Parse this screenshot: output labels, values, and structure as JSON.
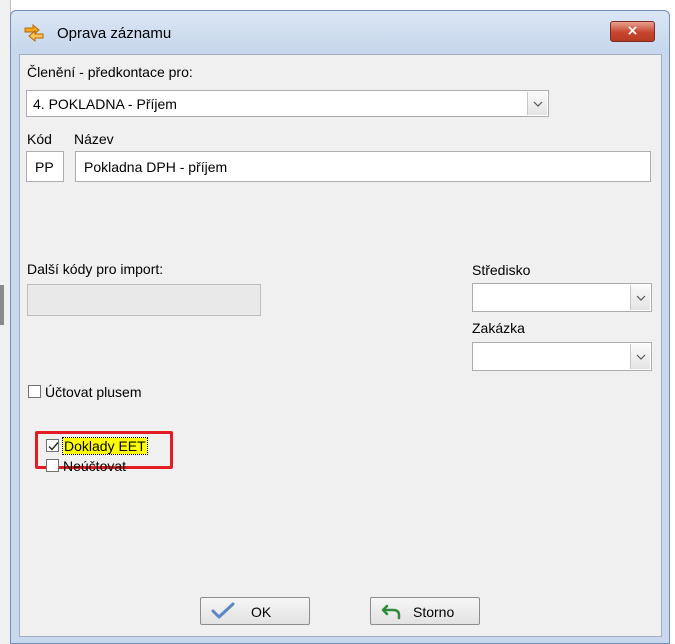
{
  "window": {
    "title": "Oprava záznamu",
    "close_label": "×"
  },
  "form": {
    "cleneni_label": "Členění - předkontace pro:",
    "cleneni_value": "4. POKLADNA - Příjem",
    "kod_label": "Kód",
    "kod_value": "PP",
    "nazev_label": "Název",
    "nazev_value": "Pokladna DPH - příjem",
    "dalsi_kody_label": "Další kódy pro import:",
    "dalsi_kody_value": "",
    "stredisko_label": "Středisko",
    "stredisko_value": "",
    "zakazka_label": "Zakázka",
    "zakazka_value": ""
  },
  "checkboxes": [
    {
      "label": "Účtovat plusem",
      "checked": false
    },
    {
      "label": "Doklady EET",
      "checked": true
    },
    {
      "label": "Neúčtovat",
      "checked": false
    }
  ],
  "buttons": {
    "ok_label": "OK",
    "storno_label": "Storno"
  },
  "colors": {
    "highlight_border": "#e31b23",
    "focus_background": "#ffff00",
    "close_button": "#c8452f"
  },
  "icons": {
    "title": "edit-arrows-icon",
    "ok": "checkmark-icon",
    "storno": "undo-arrow-icon"
  }
}
